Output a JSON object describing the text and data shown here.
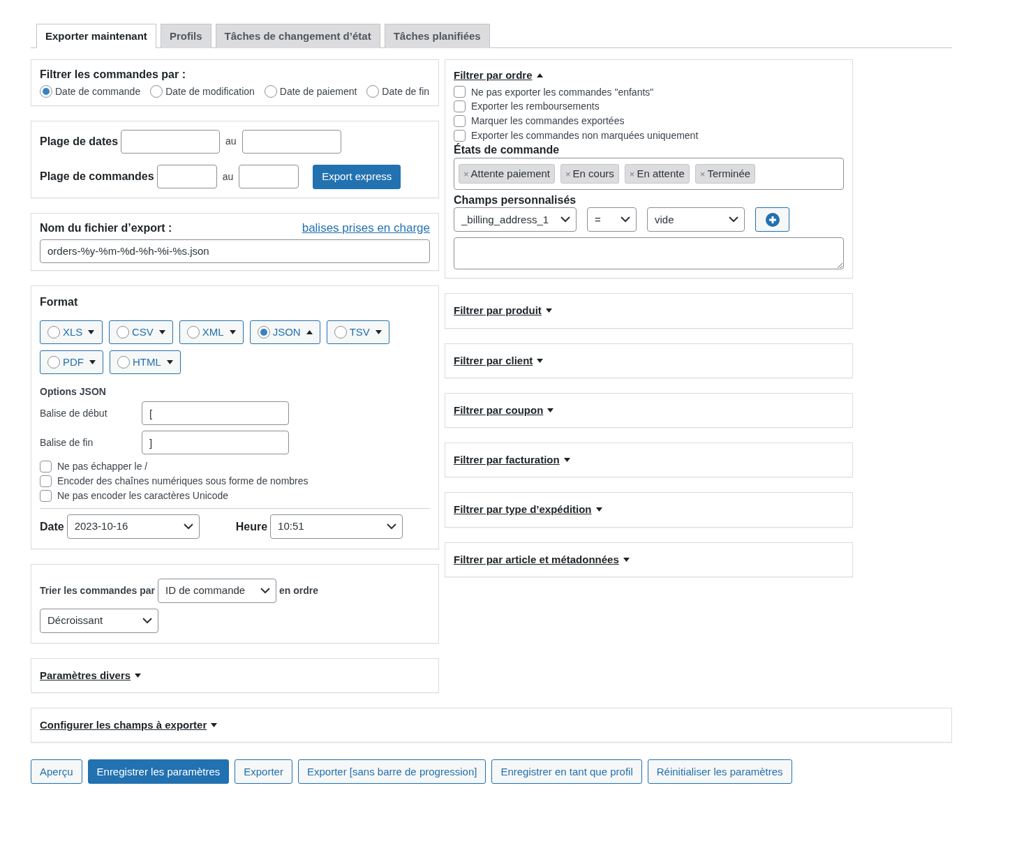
{
  "tabs": [
    {
      "label": "Exporter maintenant",
      "selected": true
    },
    {
      "label": "Profils",
      "selected": false
    },
    {
      "label": "Tâches de changement d’état",
      "selected": false
    },
    {
      "label": "Tâches planifiées",
      "selected": false
    }
  ],
  "filter_by": {
    "title": "Filtrer les commandes par :",
    "options": [
      {
        "label": "Date de commande",
        "selected": true
      },
      {
        "label": "Date de modification",
        "selected": false
      },
      {
        "label": "Date de paiement",
        "selected": false
      },
      {
        "label": "Date de fin",
        "selected": false
      }
    ]
  },
  "ranges": {
    "date_label": "Plage de dates",
    "date_separator": "au",
    "order_label": "Plage de commandes",
    "order_separator": "au",
    "express_button": "Export express"
  },
  "filename": {
    "label": "Nom du fichier d’export  :",
    "link": "balises prises en charge",
    "value": "orders-%y-%m-%d-%h-%i-%s.json"
  },
  "format": {
    "title": "Format",
    "options": [
      {
        "label": "XLS",
        "selected": false,
        "expanded": false
      },
      {
        "label": "CSV",
        "selected": false,
        "expanded": false
      },
      {
        "label": "XML",
        "selected": false,
        "expanded": false
      },
      {
        "label": "JSON",
        "selected": true,
        "expanded": true
      },
      {
        "label": "TSV",
        "selected": false,
        "expanded": false
      },
      {
        "label": "PDF",
        "selected": false,
        "expanded": false
      },
      {
        "label": "HTML",
        "selected": false,
        "expanded": false
      }
    ],
    "options_title": "Options JSON",
    "fields": [
      {
        "label": "Balise de début",
        "value": "["
      },
      {
        "label": "Balise de fin",
        "value": "]"
      }
    ],
    "checkboxes": [
      {
        "label": "Ne pas échapper le /",
        "checked": false
      },
      {
        "label": "Encoder des chaînes numériques sous forme de nombres",
        "checked": false
      },
      {
        "label": "Ne pas encoder les caractères Unicode",
        "checked": false
      }
    ],
    "date_label": "Date",
    "date_value": "2023-10-16",
    "time_label": "Heure",
    "time_value": "10:51"
  },
  "sort": {
    "label": "Trier les commandes par",
    "field": "ID de commande",
    "suffix": "en ordre",
    "direction": "Décroissant"
  },
  "misc": {
    "label": "Paramètres divers",
    "expanded": false
  },
  "order_filter": {
    "label": "Filtrer par ordre",
    "expanded": true,
    "checkboxes": [
      {
        "label": "Ne pas exporter les commandes \"enfants\"",
        "checked": false
      },
      {
        "label": "Exporter les remboursements",
        "checked": false
      },
      {
        "label": "Marquer les commandes exportées",
        "checked": false
      },
      {
        "label": "Exporter les commandes non marquées uniquement",
        "checked": false
      }
    ],
    "statuses_title": "États de commande",
    "statuses": [
      {
        "remove": "×",
        "label": "Attente paiement"
      },
      {
        "remove": "×",
        "label": "En cours"
      },
      {
        "remove": "×",
        "label": "En attente"
      },
      {
        "remove": "×",
        "label": "Terminée"
      }
    ],
    "custom_title": "Champs personnalisés",
    "custom_field": "_billing_address_1",
    "custom_operator": "=",
    "custom_value": "vide"
  },
  "filter_sections": [
    {
      "label": "Filtrer par produit",
      "expanded": false
    },
    {
      "label": "Filtrer par client",
      "expanded": false
    },
    {
      "label": "Filtrer par coupon",
      "expanded": false
    },
    {
      "label": "Filtrer par facturation",
      "expanded": false
    },
    {
      "label": "Filtrer par type d’expédition",
      "expanded": false
    },
    {
      "label": "Filtrer par article et métadonnées",
      "expanded": false
    }
  ],
  "fields_section": {
    "label": "Configurer les champs à exporter",
    "expanded": false
  },
  "buttons": [
    {
      "label": "Aperçu",
      "kind": "secondary"
    },
    {
      "label": "Enregistrer les paramètres",
      "kind": "primary"
    },
    {
      "label": "Exporter",
      "kind": "secondary"
    },
    {
      "label": "Exporter [sans barre de progression]",
      "kind": "secondary"
    },
    {
      "label": "Enregistrer en tant que profil",
      "kind": "secondary"
    },
    {
      "label": "Réinitialiser les paramètres",
      "kind": "secondary"
    }
  ]
}
